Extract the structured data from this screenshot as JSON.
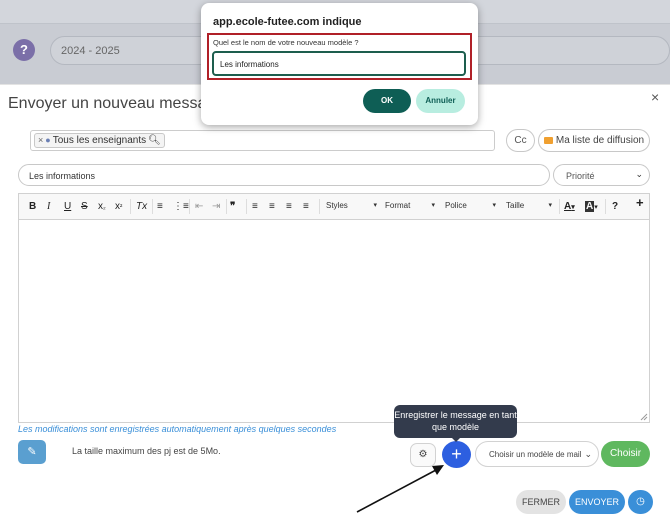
{
  "background": {
    "year": "2024 - 2025",
    "help_glyph": "?"
  },
  "modal": {
    "title": "Envoyer un nouveau message",
    "close_glyph": "×"
  },
  "recipients": {
    "tag_remove": "×",
    "tag_label": "Tous les enseignants",
    "cc_label": "Cc",
    "list_label": "Ma liste de diffusion"
  },
  "subject": {
    "value": "Les informations"
  },
  "priority": {
    "label": "Priorité",
    "options": [
      "Priorité"
    ]
  },
  "editor_toolbar": {
    "bold": "B",
    "italic": "I",
    "underline": "U",
    "strike": "S",
    "subscript_base": "x",
    "subscript_mark": "₂",
    "superscript_base": "x",
    "superscript_mark": "²",
    "clear_format": "Tx",
    "blockquote": "❞",
    "styles": "Styles",
    "format": "Format",
    "font": "Police",
    "size": "Taille",
    "text_color": "A",
    "bg_color": "A",
    "help": "?",
    "add": "+"
  },
  "autosave_note": "Les modifications sont enregistrées automatiquement après quelques secondes",
  "attachment": {
    "size_note": "La taille maximum des pj est de 5Mo."
  },
  "templates": {
    "select_placeholder": "Choisir un modèle de mail",
    "choose_label": "Choisir",
    "add_glyph": "+",
    "tooltip": "Enregistrer le message en tant que modèle"
  },
  "footer": {
    "close_label": "FERMER",
    "send_label": "ENVOYER"
  },
  "prompt_dialog": {
    "title": "app.ecole-futee.com indique",
    "question": "Quel est le nom de votre nouveau modèle ?",
    "input_value": "Les informations",
    "ok_label": "OK",
    "cancel_label": "Annuler"
  },
  "colors": {
    "accent_blue": "#3a8fd8",
    "add_button_blue": "#2d5fe0",
    "choose_green": "#5fb85f",
    "dialog_ok": "#0e5e55",
    "dialog_cancel_bg": "#b8ede0",
    "highlight_red": "#b02028",
    "tooltip_bg": "#333b4c"
  }
}
